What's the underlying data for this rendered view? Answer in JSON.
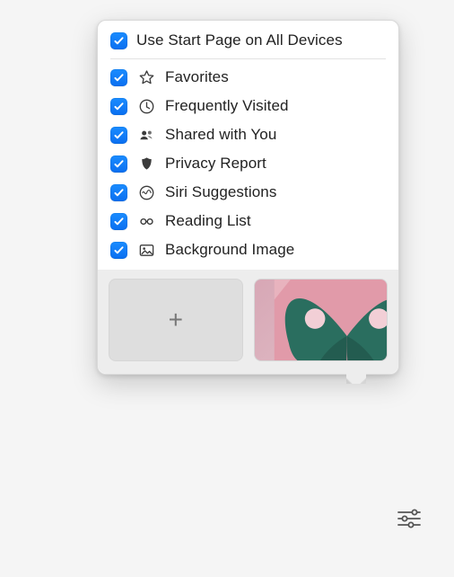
{
  "header": {
    "label": "Use Start Page on All Devices",
    "checked": true
  },
  "options": [
    {
      "id": "favorites",
      "icon": "star-icon",
      "label": "Favorites",
      "checked": true
    },
    {
      "id": "frequently-visited",
      "icon": "clock-icon",
      "label": "Frequently Visited",
      "checked": true
    },
    {
      "id": "shared-with-you",
      "icon": "people-icon",
      "label": "Shared with You",
      "checked": true
    },
    {
      "id": "privacy-report",
      "icon": "shield-icon",
      "label": "Privacy Report",
      "checked": true
    },
    {
      "id": "siri-suggestions",
      "icon": "siri-icon",
      "label": "Siri Suggestions",
      "checked": true
    },
    {
      "id": "reading-list",
      "icon": "glasses-icon",
      "label": "Reading List",
      "checked": true
    },
    {
      "id": "background-image",
      "icon": "image-icon",
      "label": "Background Image",
      "checked": true
    }
  ],
  "thumbnails": {
    "add_label": "+",
    "wallpaper_name": "butterfly"
  },
  "colors": {
    "accent": "#0a6ff0"
  }
}
